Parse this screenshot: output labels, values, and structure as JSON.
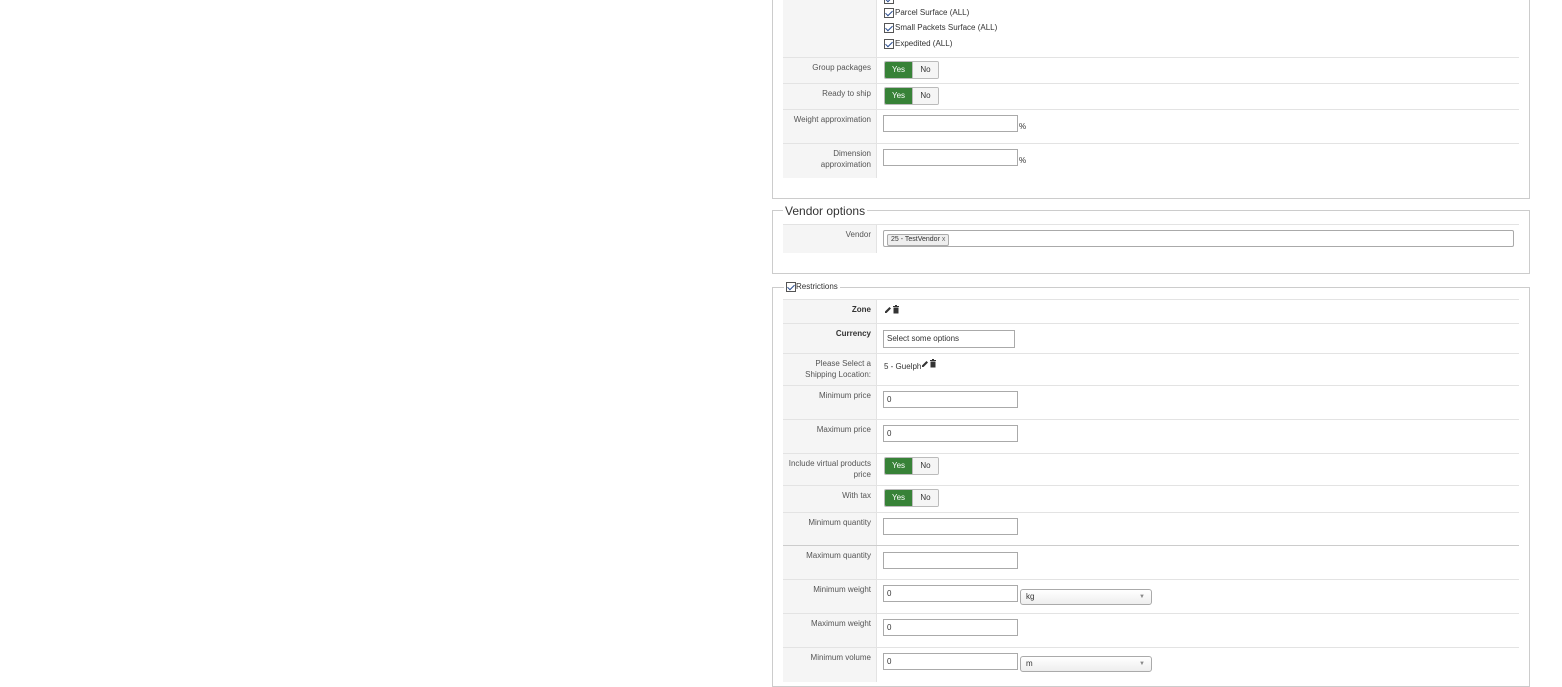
{
  "carriers": [
    "Parcel Surface (ALL)",
    "Small Packets Surface (ALL)",
    "Expedited (ALL)"
  ],
  "toggle": {
    "yes": "Yes",
    "no": "No"
  },
  "shipping": {
    "group_packages": "Group packages",
    "ready_to_ship": "Ready to ship",
    "weight_approx": "Weight approximation",
    "dimension_approx": "Dimension approximation",
    "percent": "%"
  },
  "vendor": {
    "legend": "Vendor options",
    "label": "Vendor",
    "tag": "25 - TestVendor",
    "remove": "x"
  },
  "restrictions": {
    "legend": "Restrictions",
    "zone": "Zone",
    "currency": "Currency",
    "currency_placeholder": "Select some options",
    "location_label": "Please Select a Shipping Location:",
    "location_value": "5 - Guelph",
    "min_price": "Minimum price",
    "min_price_value": "0",
    "max_price": "Maximum price",
    "max_price_value": "0",
    "include_virtual": "Include virtual products price",
    "with_tax": "With tax",
    "min_qty": "Minimum quantity",
    "max_qty": "Maximum quantity",
    "min_weight": "Minimum weight",
    "min_weight_value": "0",
    "weight_unit": "kg",
    "max_weight": "Maximum weight",
    "max_weight_value": "0",
    "min_volume": "Minimum volume",
    "min_volume_value": "0",
    "volume_unit": "m"
  }
}
